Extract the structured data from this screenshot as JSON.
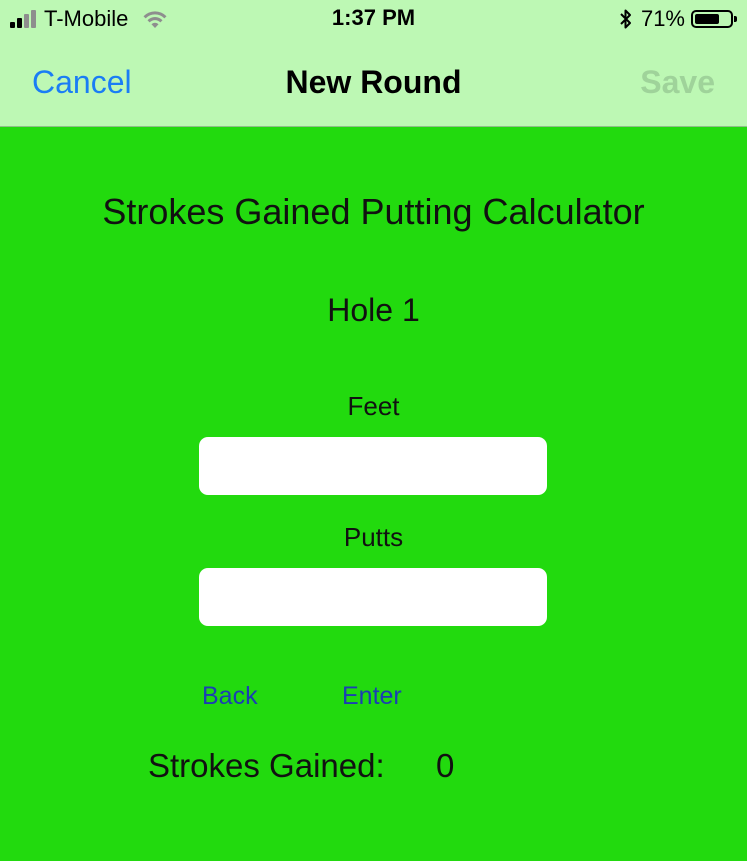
{
  "status_bar": {
    "carrier": "T-Mobile",
    "time": "1:37 PM",
    "battery_percent": "71%",
    "battery_level": 0.71,
    "signal_bars_active": 2,
    "signal_bars_total": 4,
    "icons": [
      "cellular-signal-icon",
      "wifi-icon",
      "bluetooth-icon",
      "battery-icon"
    ]
  },
  "nav": {
    "cancel_label": "Cancel",
    "title": "New Round",
    "save_label": "Save"
  },
  "main": {
    "title": "Strokes Gained Putting Calculator",
    "hole_label": "Hole 1",
    "feet_label": "Feet",
    "feet_value": "",
    "putts_label": "Putts",
    "putts_value": "",
    "back_label": "Back",
    "enter_label": "Enter",
    "strokes_gained_label": "Strokes Gained:",
    "strokes_gained_value": "0"
  },
  "colors": {
    "background": "#22da0e",
    "bar": "#bdf8b4",
    "link_blue": "#1a7df5",
    "button_blue": "#1b3fb3",
    "save_disabled": "#9fd39a"
  }
}
